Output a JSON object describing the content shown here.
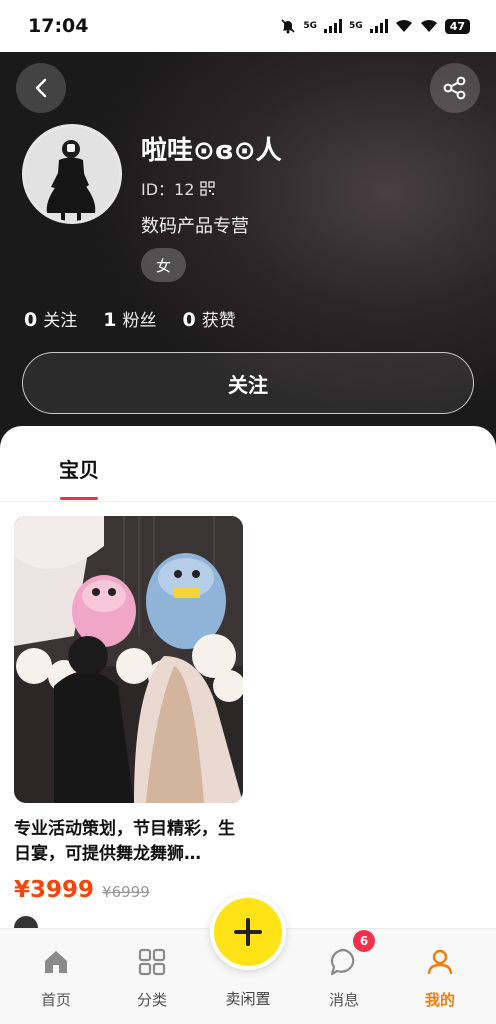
{
  "status_bar": {
    "time": "17:04",
    "network_1": "5G",
    "network_2": "5G",
    "battery": "47",
    "icons": [
      "mute-icon",
      "signal-icon",
      "signal-icon",
      "wifi-icon",
      "wifi-icon",
      "battery-icon"
    ]
  },
  "header": {
    "back_icon": "back-icon",
    "share_icon": "share-icon"
  },
  "profile": {
    "username": "啦哇⊙ɞ⊙人",
    "id_label": "ID：12",
    "bio": "数码产品专营",
    "gender": "女",
    "stats": [
      {
        "count": "0",
        "label": "关注"
      },
      {
        "count": "1",
        "label": "粉丝"
      },
      {
        "count": "0",
        "label": "获赞"
      }
    ],
    "follow_button": "关注"
  },
  "tabs": [
    {
      "label": "宝贝",
      "active": true
    }
  ],
  "accent_colors": {
    "tab_underline": "#e8334a",
    "price": "#f2460c",
    "nav_active": "#f27e0c",
    "publish": "#ffe316"
  },
  "listing": {
    "title": "专业活动策划，节目精彩，生日宴，可提供舞龙舞狮…",
    "price": "¥3999",
    "original_price": "¥6999"
  },
  "bottom_nav": {
    "items": [
      {
        "label": "首页",
        "icon": "home-icon"
      },
      {
        "label": "分类",
        "icon": "grid-icon"
      },
      {
        "label": "卖闲置",
        "icon": "plus-icon"
      },
      {
        "label": "消息",
        "icon": "chat-icon",
        "badge": "6"
      },
      {
        "label": "我的",
        "icon": "person-icon",
        "active": true
      }
    ]
  }
}
